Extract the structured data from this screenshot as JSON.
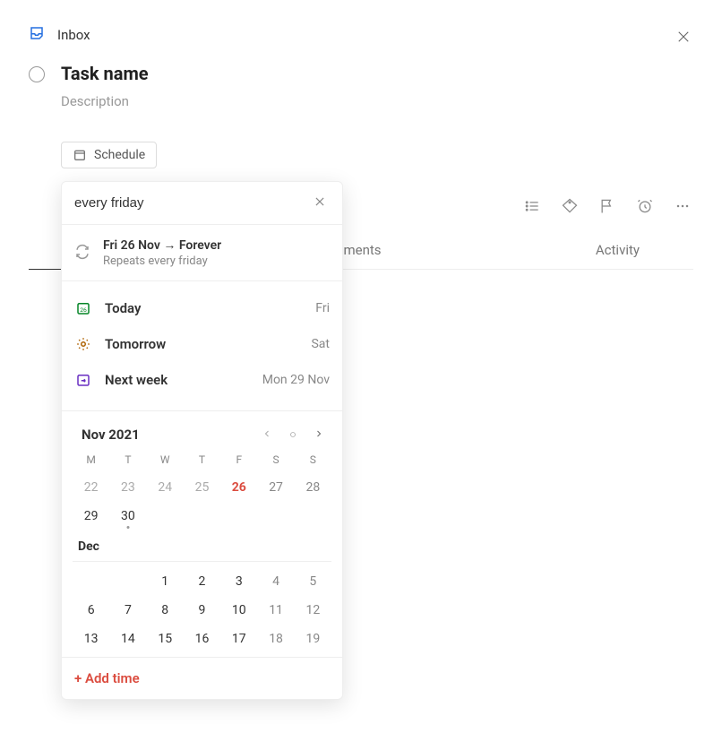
{
  "header": {
    "inbox_label": "Inbox"
  },
  "task": {
    "name": "Task name",
    "description": "Description"
  },
  "schedule": {
    "chip_label": "Schedule",
    "search_value": "every friday",
    "suggestion": {
      "title": "Fri 26 Nov → Forever",
      "subtitle": "Repeats every friday"
    },
    "quick": [
      {
        "label": "Today",
        "day": "Fri"
      },
      {
        "label": "Tomorrow",
        "day": "Sat"
      },
      {
        "label": "Next week",
        "day": "Mon 29 Nov"
      }
    ],
    "calendar": {
      "month1_label": "Nov 2021",
      "dow": [
        "M",
        "T",
        "W",
        "T",
        "F",
        "S",
        "S"
      ],
      "month1_days": [
        {
          "n": "22",
          "cls": "past"
        },
        {
          "n": "23",
          "cls": "past"
        },
        {
          "n": "24",
          "cls": "past"
        },
        {
          "n": "25",
          "cls": "past"
        },
        {
          "n": "26",
          "cls": "today"
        },
        {
          "n": "27",
          "cls": "weekend"
        },
        {
          "n": "28",
          "cls": "weekend"
        },
        {
          "n": "29",
          "cls": ""
        },
        {
          "n": "30",
          "cls": "marker"
        }
      ],
      "month2_label": "Dec",
      "month2_days": [
        {
          "n": "",
          "cls": ""
        },
        {
          "n": "",
          "cls": ""
        },
        {
          "n": "1",
          "cls": ""
        },
        {
          "n": "2",
          "cls": ""
        },
        {
          "n": "3",
          "cls": ""
        },
        {
          "n": "4",
          "cls": "weekend"
        },
        {
          "n": "5",
          "cls": "weekend"
        },
        {
          "n": "6",
          "cls": ""
        },
        {
          "n": "7",
          "cls": ""
        },
        {
          "n": "8",
          "cls": ""
        },
        {
          "n": "9",
          "cls": ""
        },
        {
          "n": "10",
          "cls": ""
        },
        {
          "n": "11",
          "cls": "weekend"
        },
        {
          "n": "12",
          "cls": "weekend"
        },
        {
          "n": "13",
          "cls": ""
        },
        {
          "n": "14",
          "cls": ""
        },
        {
          "n": "15",
          "cls": ""
        },
        {
          "n": "16",
          "cls": ""
        },
        {
          "n": "17",
          "cls": ""
        },
        {
          "n": "18",
          "cls": "weekend"
        },
        {
          "n": "19",
          "cls": "weekend"
        }
      ]
    },
    "add_time_label": "+ Add time"
  },
  "tabs": {
    "comments": "Comments",
    "activity": "Activity"
  }
}
